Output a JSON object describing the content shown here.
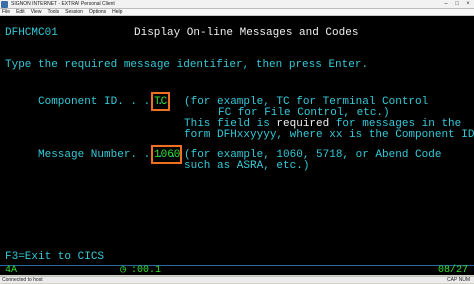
{
  "window": {
    "title": "SIGNON INTERNET - EXTRA! Personal Client",
    "controls": [
      "–",
      "□",
      "×"
    ]
  },
  "menu": [
    "File",
    "Edit",
    "View",
    "Tools",
    "Session",
    "Options",
    "Help"
  ],
  "screen": {
    "screen_id": "DFHCMC01",
    "heading": "Display On-line Messages and Codes",
    "instruction": "Type the required message identifier, then press Enter.",
    "component_label": "Component ID. . . .",
    "component_value": "TC",
    "component_help": [
      "(for example, TC for Terminal Control",
      "FC for File Control, etc.)"
    ],
    "required_note_prefix": "This field is ",
    "required_word": "required",
    "required_note_suffix": " for messages in the",
    "form_note": "form DFHxxyyyy, where xx is the Component ID.",
    "message_label": "Message Number. . . .",
    "message_value": "1060",
    "message_help": [
      "(for example, 1060, 5718, or Abend Code",
      "such as ASRA, etc.)"
    ],
    "pf_keys": "F3=Exit to CICS"
  },
  "oia": {
    "session_indicator": "4A",
    "time": ":00.1",
    "cursor": "08/27"
  },
  "status": {
    "connection": "Connected to host",
    "mode": "CAP  NUM"
  }
}
